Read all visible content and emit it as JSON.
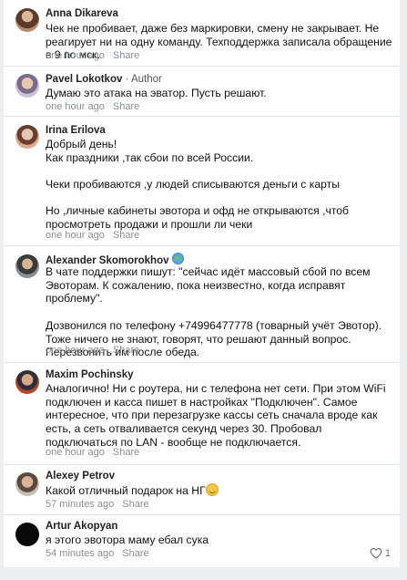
{
  "comments": [
    {
      "author": "Anna Dikareva",
      "role": "",
      "paragraphs": [
        "Чек не пробивает, даже без маркировки, смену не закрывает. Не реагирует ни на одну команду. Техподдержка записала обращение в 9 по мск."
      ],
      "time": "one hour ago",
      "share": "Share"
    },
    {
      "author": "Pavel Lokotkov",
      "role": "· Author",
      "paragraphs": [
        "Думаю это атака на эватор. Пусть решают."
      ],
      "time": "one hour ago",
      "share": "Share"
    },
    {
      "author": "Irina Erilova",
      "role": "",
      "paragraphs": [
        "Добрый день!\nКак праздники ,так сбои по всей России.",
        "Чеки пробиваются ,у людей списываются деньги с карты",
        "Но ,личные кабинеты эвотора и офд не открываются ,чтоб просмотреть продажи и прошли ли чеки"
      ],
      "time": "one hour ago",
      "share": "Share"
    },
    {
      "author": "Alexander Skomorokhov",
      "role": "",
      "badge_icon": "globe-badge-icon",
      "paragraphs": [
        "В чате поддержки пишут: \"сейчас идёт массовый сбой по всем Эвоторам. К сожалению, пока неизвестно, когда исправят проблему\".",
        "Дозвонился по телефону +74996477778 (товарный учёт Эвотор). Тоже ничего не знают, говорят, что решают данный вопрос. Перезвонить им после обеда."
      ],
      "time": "one hour ago",
      "share": "Share"
    },
    {
      "author": "Maxim Pochinsky",
      "role": "",
      "paragraphs": [
        "Аналогично! Ни с роутера, ни с телефона нет сети. При этом WiFi подключен и касса пишет в настройках \"Подключен\". Самое интересное, что при перезагрузке кассы сеть сначала вроде как есть, а сеть отваливается секунд через 30. Пробовал подключаться по LAN - вообще не подключается."
      ],
      "time": "one hour ago",
      "share": "Share"
    },
    {
      "author": "Alexey Petrov",
      "role": "",
      "paragraphs": [
        "Какой отличный подарок на НГ"
      ],
      "emoji_icon": "grinning-face-emoji-icon",
      "time": "57 minutes ago",
      "share": "Share"
    },
    {
      "author": "Artur Akopyan",
      "role": "",
      "paragraphs": [
        "я этого эвотора маму ебал сука"
      ],
      "time": "54 minutes ago",
      "share": "Share",
      "likes": "1"
    }
  ]
}
